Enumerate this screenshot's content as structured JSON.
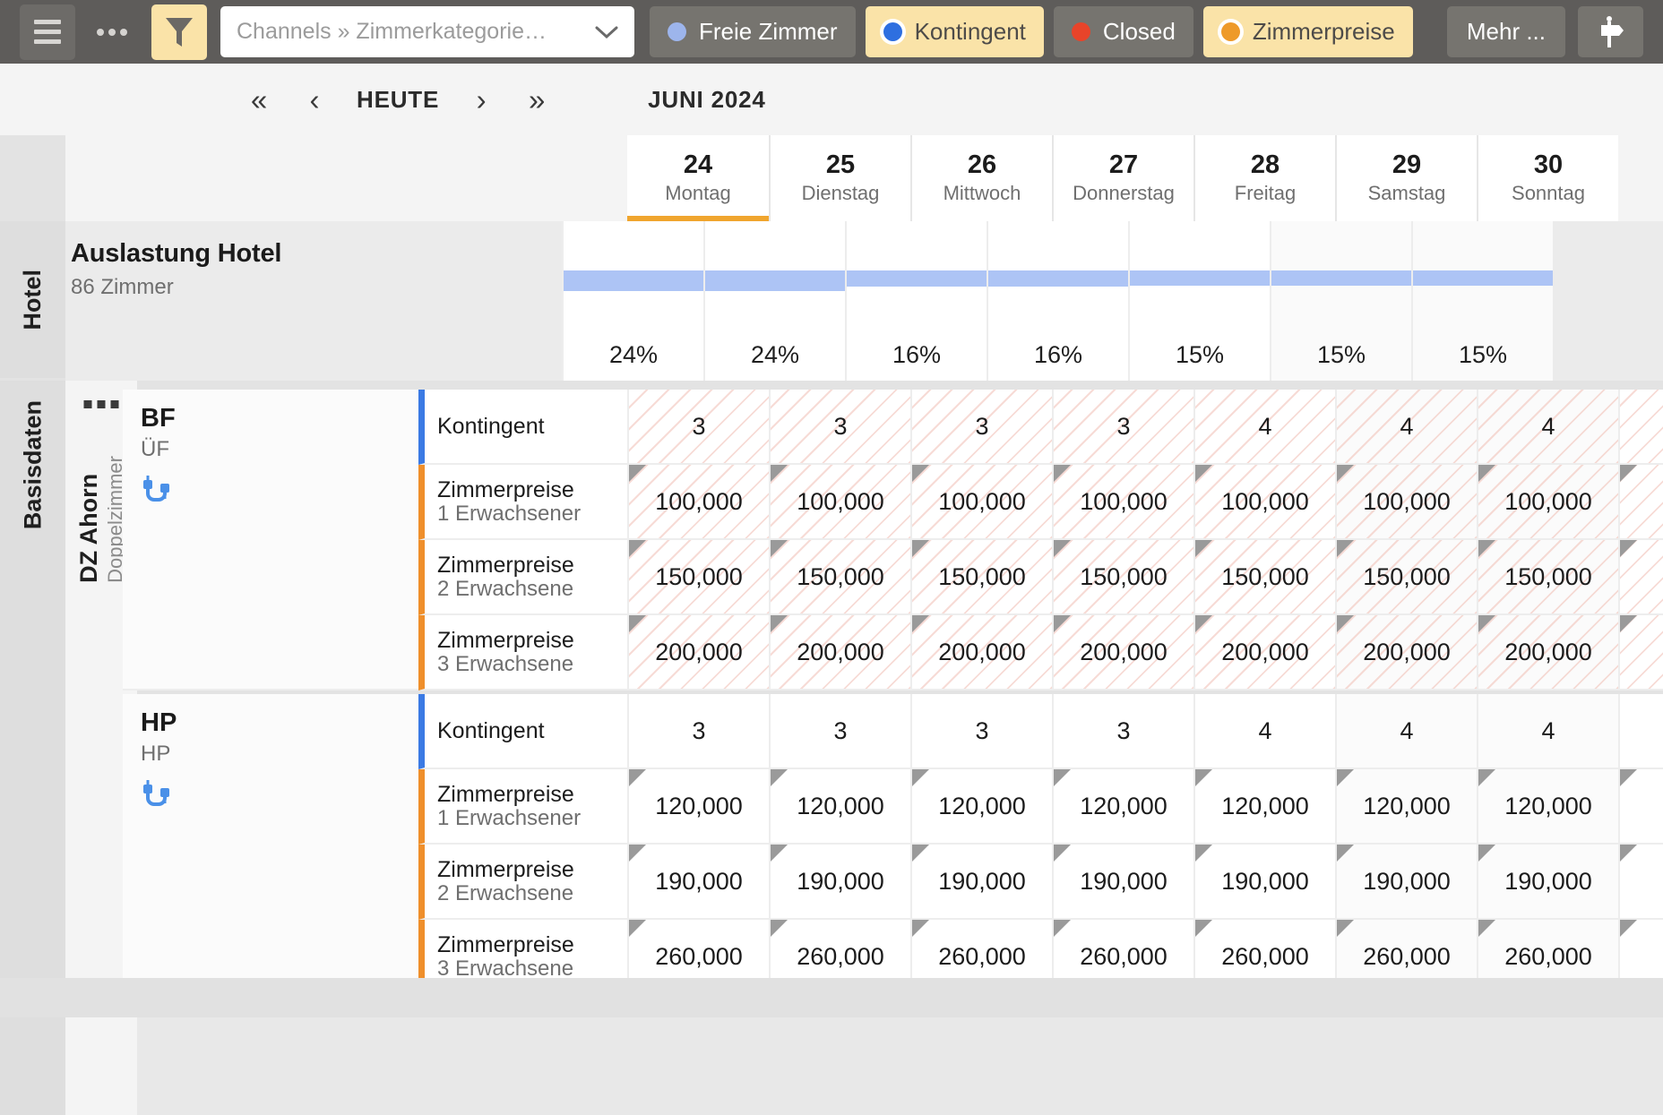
{
  "toolbar": {
    "menu_icon": "hamburger-icon",
    "overflow_icon": "more-dots-icon",
    "filter_icon": "funnel-icon",
    "search_value": "",
    "search_placeholder": "Channels » Zimmerkategorie…",
    "dropdown_icon": "chevron-down-icon",
    "legend": [
      {
        "label": "Freie Zimmer",
        "color": "#9db5ec",
        "active": false
      },
      {
        "label": "Kontingent",
        "color": "#2e6fe0",
        "active": true
      },
      {
        "label": "Closed",
        "color": "#e8442a",
        "active": false
      },
      {
        "label": "Zimmerpreise",
        "color": "#ee9a2a",
        "active": true
      }
    ],
    "more_label": "Mehr ...",
    "signpost_icon": "signpost-icon",
    "bg_color": "#5e5c5a",
    "active_bg": "#fae3a8"
  },
  "datenav": {
    "first_icon": "chevron-double-left-icon",
    "prev_icon": "chevron-left-icon",
    "today_label": "HEUTE",
    "next_icon": "chevron-right-icon",
    "last_icon": "chevron-double-right-icon",
    "month_label": "JUNI 2024"
  },
  "days": [
    {
      "num": "24",
      "name": "Montag",
      "today": true,
      "weekend": false
    },
    {
      "num": "25",
      "name": "Dienstag",
      "today": false,
      "weekend": false
    },
    {
      "num": "26",
      "name": "Mittwoch",
      "today": false,
      "weekend": false
    },
    {
      "num": "27",
      "name": "Donnerstag",
      "today": false,
      "weekend": false
    },
    {
      "num": "28",
      "name": "Freitag",
      "today": false,
      "weekend": false
    },
    {
      "num": "29",
      "name": "Samstag",
      "today": false,
      "weekend": true
    },
    {
      "num": "30",
      "name": "Sonntag",
      "today": false,
      "weekend": true
    }
  ],
  "rails": {
    "hotel_label": "Hotel",
    "basedata_label": "Basisdaten"
  },
  "hotel": {
    "title": "Auslastung Hotel",
    "subtitle": "86 Zimmer",
    "occupancy": [
      "24%",
      "24%",
      "16%",
      "16%",
      "15%",
      "15%",
      "15%"
    ],
    "bar_color": "#adc4f5"
  },
  "category": {
    "menu_icon": "more-dots-icon",
    "name": "DZ Ahorn",
    "subtitle": "Doppelzimmer"
  },
  "rateplans": [
    {
      "code": "BF",
      "sub": "ÜF",
      "plug_icon": "channel-connector-icon",
      "hatched": true,
      "rows": [
        {
          "label": "Kontingent",
          "sub": "",
          "accent": "#3b7ae4",
          "corner": false,
          "values": [
            "3",
            "3",
            "3",
            "3",
            "4",
            "4",
            "4"
          ]
        },
        {
          "label": "Zimmerpreise",
          "sub": "1 Erwachsener",
          "accent": "#ef8f2b",
          "corner": true,
          "values": [
            "100,000",
            "100,000",
            "100,000",
            "100,000",
            "100,000",
            "100,000",
            "100,000"
          ]
        },
        {
          "label": "Zimmerpreise",
          "sub": "2 Erwachsene",
          "accent": "#ef8f2b",
          "corner": true,
          "values": [
            "150,000",
            "150,000",
            "150,000",
            "150,000",
            "150,000",
            "150,000",
            "150,000"
          ]
        },
        {
          "label": "Zimmerpreise",
          "sub": "3 Erwachsene",
          "accent": "#ef8f2b",
          "corner": true,
          "values": [
            "200,000",
            "200,000",
            "200,000",
            "200,000",
            "200,000",
            "200,000",
            "200,000"
          ]
        }
      ]
    },
    {
      "code": "HP",
      "sub": "HP",
      "plug_icon": "channel-connector-icon",
      "hatched": false,
      "rows": [
        {
          "label": "Kontingent",
          "sub": "",
          "accent": "#3b7ae4",
          "corner": false,
          "values": [
            "3",
            "3",
            "3",
            "3",
            "4",
            "4",
            "4"
          ]
        },
        {
          "label": "Zimmerpreise",
          "sub": "1 Erwachsener",
          "accent": "#ef8f2b",
          "corner": true,
          "values": [
            "120,000",
            "120,000",
            "120,000",
            "120,000",
            "120,000",
            "120,000",
            "120,000"
          ]
        },
        {
          "label": "Zimmerpreise",
          "sub": "2 Erwachsene",
          "accent": "#ef8f2b",
          "corner": true,
          "values": [
            "190,000",
            "190,000",
            "190,000",
            "190,000",
            "190,000",
            "190,000",
            "190,000"
          ]
        },
        {
          "label": "Zimmerpreise",
          "sub": "3 Erwachsene",
          "accent": "#ef8f2b",
          "corner": true,
          "values": [
            "260,000",
            "260,000",
            "260,000",
            "260,000",
            "260,000",
            "260,000",
            "260,000"
          ]
        }
      ]
    }
  ],
  "scrollbar": {
    "horizontal_visible": true
  }
}
